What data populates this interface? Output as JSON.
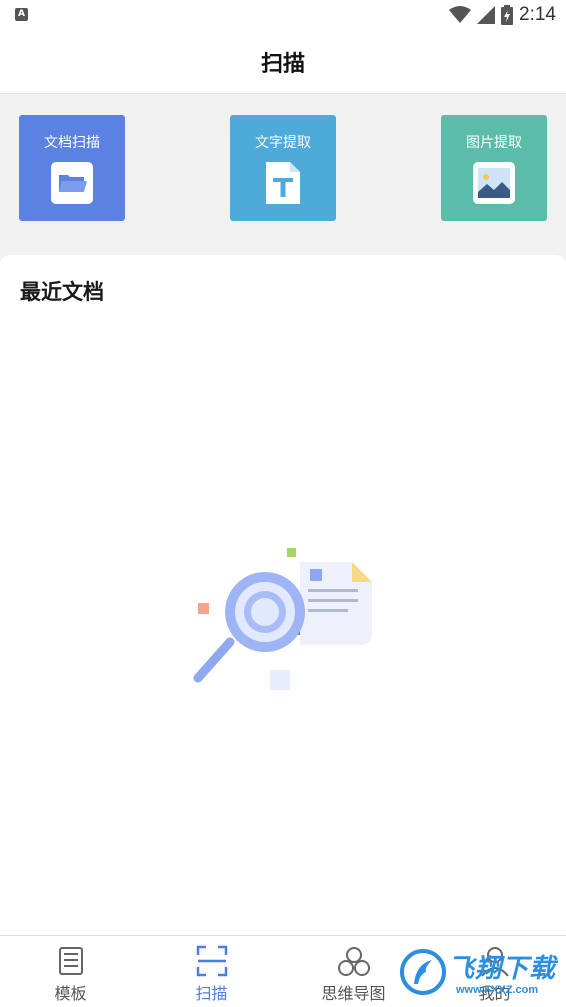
{
  "status_bar": {
    "time": "2:14",
    "notification_icon": "a-icon",
    "icons": [
      "wifi-icon",
      "signal-icon",
      "battery-icon"
    ]
  },
  "header": {
    "title": "扫描"
  },
  "tools": [
    {
      "label": "文档扫描",
      "icon": "folder-icon",
      "color": "#5b82e3"
    },
    {
      "label": "文字提取",
      "icon": "text-file-icon",
      "color": "#4eaad8"
    },
    {
      "label": "图片提取",
      "icon": "image-icon",
      "color": "#5bbcaa"
    }
  ],
  "recent": {
    "title": "最近文档",
    "empty_illustration": "magnifier-document-illustration"
  },
  "bottom_nav": [
    {
      "label": "模板",
      "icon": "template-icon",
      "active": false
    },
    {
      "label": "扫描",
      "icon": "scan-icon",
      "active": true
    },
    {
      "label": "思维导图",
      "icon": "mindmap-icon",
      "active": false
    },
    {
      "label": "我的",
      "icon": "profile-icon",
      "active": false
    }
  ],
  "watermark": {
    "text": "飞翔下载",
    "sub": "www.FXXZ.com"
  },
  "colors": {
    "accent": "#4a7fe0",
    "background_gray": "#f1f1f1"
  }
}
